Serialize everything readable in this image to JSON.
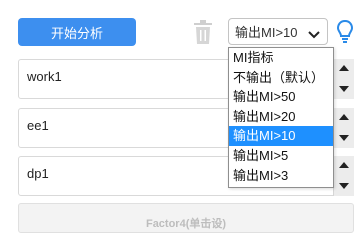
{
  "toolbar": {
    "analyze_label": "开始分析",
    "mi_select_value": "输出MI>10"
  },
  "panels": [
    {
      "label": "work1"
    },
    {
      "label": "ee1"
    },
    {
      "label": "dp1"
    }
  ],
  "footer_label": "Factor4(单击设)",
  "dropdown": {
    "options": [
      "MI指标",
      "不输出（默认）",
      "输出MI>50",
      "输出MI>20",
      "输出MI>10",
      "输出MI>5",
      "输出MI>3"
    ],
    "selected_index": 4
  },
  "colors": {
    "primary": "#3d8fef",
    "selected_option": "#1e90ff",
    "bulb": "#2a8ae8"
  }
}
